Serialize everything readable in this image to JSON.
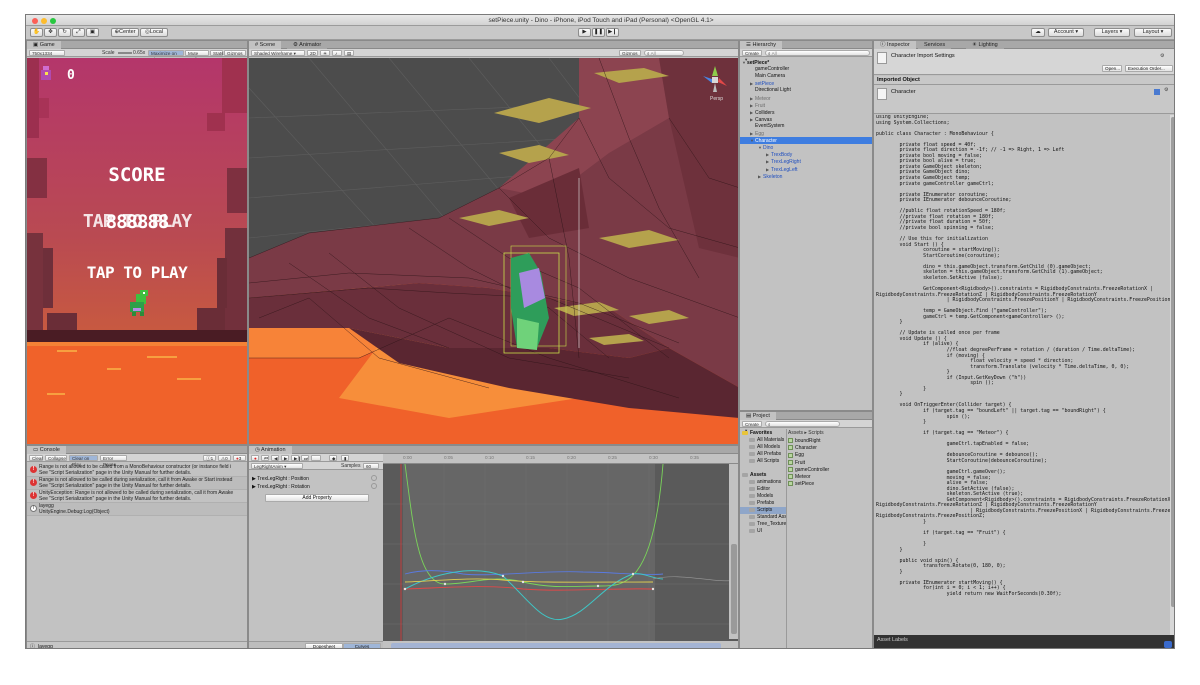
{
  "window": {
    "title": "setPiece.unity - Dino - iPhone, iPod Touch and iPad (Personal) <OpenGL 4.1>"
  },
  "toolbar": {
    "pivot_label": "Center",
    "space_label": "Local",
    "account_label": "Account",
    "layers_label": "Layers",
    "layout_label": "Layout"
  },
  "game": {
    "tab": "Game",
    "resolution": "750x1334",
    "scale_label": "Scale",
    "scale_value": "0.65x",
    "maximize": "Maximize on Play",
    "mute": "Mute audio",
    "stats": "Stats",
    "gizmos": "Gizmos",
    "counter": "0",
    "score_title": "SCORE",
    "score_digits": "888888",
    "overlap_text": "TAP TO PLAY",
    "tap_to_play": "TAP TO PLAY"
  },
  "scene": {
    "tab": "Scene",
    "animator_tab": "Animator",
    "shading": "Shaded Wireframe",
    "mode_2d": "2D",
    "gizmos": "Gizmos",
    "search_placeholder": "All",
    "persp": "Persp"
  },
  "console": {
    "tab": "Console",
    "buttons": [
      "Clear",
      "Collapse",
      "Clear on Play",
      "Error Pause"
    ],
    "counts": {
      "info": "1",
      "warn": "0",
      "err": "3"
    },
    "entries": [
      {
        "type": "error",
        "line1": "Range is not allowed to be called from a MonoBehaviour constructor (or instance field i",
        "line2": "See \"Script Serialization\" page in the Unity Manual for further details."
      },
      {
        "type": "error",
        "line1": "Range is not allowed to be called during serialization, call it from Awake or Start instead",
        "line2": "See \"Script Serialization\" page in the Unity Manual for further details."
      },
      {
        "type": "error",
        "line1": "UnityException: Range is not allowed to be called during serialization, call it from Awake",
        "line2": "See \"Script Serialization\" page in the Unity Manual for further details."
      },
      {
        "type": "info",
        "line1": "layegg",
        "line2": "UnityEngine.Debug:Log(Object)"
      }
    ],
    "status": "layegg"
  },
  "animation": {
    "tab": "Animation",
    "clip": "LegRightAnim",
    "samples_label": "Samples",
    "samples_value": "60",
    "properties": [
      "TrexLegRight : Position",
      "TrexLegRight : Rotation"
    ],
    "add_property": "Add Property",
    "dopesheet": "Dopesheet",
    "curves": "Curves",
    "timeline": [
      "0:00",
      "0:05",
      "0:10",
      "0:15",
      "0:20",
      "0:25",
      "0:30",
      "0:35"
    ]
  },
  "hierarchy": {
    "tab": "Hierarchy",
    "create": "Create",
    "search_placeholder": "All",
    "items": [
      {
        "label": "setPiece*",
        "indent": 0,
        "style": "bold",
        "arrow": "▼"
      },
      {
        "label": "gameController",
        "indent": 1,
        "style": "normal",
        "arrow": ""
      },
      {
        "label": "Main Camera",
        "indent": 1,
        "style": "normal",
        "arrow": ""
      },
      {
        "label": "setPiece",
        "indent": 1,
        "style": "blue",
        "arrow": "▶"
      },
      {
        "label": "Directional Light",
        "indent": 1,
        "style": "normal",
        "arrow": ""
      },
      {
        "label": "Meteor",
        "indent": 1,
        "style": "grey",
        "arrow": "▶"
      },
      {
        "label": "Fruit",
        "indent": 1,
        "style": "grey",
        "arrow": "▶"
      },
      {
        "label": "Colliders",
        "indent": 1,
        "style": "normal",
        "arrow": "▶"
      },
      {
        "label": "Canvas",
        "indent": 1,
        "style": "normal",
        "arrow": "▶"
      },
      {
        "label": "EventSystem",
        "indent": 1,
        "style": "normal",
        "arrow": ""
      },
      {
        "label": "Egg",
        "indent": 1,
        "style": "grey",
        "arrow": "▶"
      },
      {
        "label": "Character",
        "indent": 1,
        "style": "selected",
        "arrow": "▼"
      },
      {
        "label": "Dino",
        "indent": 2,
        "style": "blue",
        "arrow": "▼"
      },
      {
        "label": "TrexBody",
        "indent": 3,
        "style": "blue",
        "arrow": "▶"
      },
      {
        "label": "TrexLegRight",
        "indent": 3,
        "style": "blue",
        "arrow": "▶"
      },
      {
        "label": "TrexLegLeft",
        "indent": 3,
        "style": "blue",
        "arrow": "▶"
      },
      {
        "label": "Skeleton",
        "indent": 2,
        "style": "blue",
        "arrow": "▶"
      }
    ]
  },
  "project": {
    "tab": "Project",
    "create": "Create",
    "breadcrumb": "Assets ▸ Scripts",
    "tree": [
      {
        "label": "Favorites",
        "indent": 0,
        "bold": true
      },
      {
        "label": "All Materials",
        "indent": 1
      },
      {
        "label": "All Models",
        "indent": 1
      },
      {
        "label": "All Prefabs",
        "indent": 1
      },
      {
        "label": "All Scripts",
        "indent": 1
      },
      {
        "label": "",
        "indent": 0
      },
      {
        "label": "Assets",
        "indent": 0,
        "bold": true
      },
      {
        "label": "animations",
        "indent": 1
      },
      {
        "label": "Editor",
        "indent": 1
      },
      {
        "label": "Models",
        "indent": 1
      },
      {
        "label": "Prefabs",
        "indent": 1
      },
      {
        "label": "Scripts",
        "indent": 1,
        "selected": true
      },
      {
        "label": "Standard Assets",
        "indent": 1
      },
      {
        "label": "Tree_Textures",
        "indent": 1
      },
      {
        "label": "UI",
        "indent": 1
      }
    ],
    "files": [
      "boundRight",
      "Character",
      "Egg",
      "Fruit",
      "gameController",
      "Meteor",
      "setPiece"
    ]
  },
  "inspector": {
    "tab": "Inspector",
    "services_tab": "Services",
    "lighting_tab": "Lighting",
    "header": "Character Import Settings",
    "open_button": "Open...",
    "exec_order_button": "Execution Order...",
    "imported_object": "Imported Object",
    "object_name": "Character",
    "asset_labels": "Asset Labels",
    "code": [
      "using UnityEngine;",
      "using System.Collections;",
      "",
      "public class Character : MonoBehaviour {",
      "",
      "        private float speed = 40f;",
      "        private float direction = -1f; // -1 => Right, 1 => Left",
      "        private bool moving = false;",
      "        private bool alive = true;",
      "        private GameObject skeleton;",
      "        private GameObject dino;",
      "        private GameObject temp;",
      "        private gameController gameCtrl;",
      "",
      "        private IEnumerator coroutine;",
      "        private IEnumerator debounceCoroutine;",
      "",
      "        //public float rotationSpeed = 180f;",
      "        //private float rotation = 180f;",
      "        //private float duration = 50f;",
      "        //private bool spinning = false;",
      "",
      "        // Use this for initialization",
      "        void Start () {",
      "                coroutine = startMoving();",
      "                StartCoroutine(coroutine);",
      "",
      "                dino = this.gameObject.transform.GetChild (0).gameObject;",
      "                skeleton = this.gameObject.transform.GetChild (1).gameObject;",
      "                skeleton.SetActive (false);",
      "",
      "                GetComponent<Rigidbody>().constraints = RigidbodyConstraints.FreezeRotationX |",
      "RigidbodyConstraints.FreezeRotationZ | RigidbodyConstraints.FreezeRotationY",
      "                        | RigidbodyConstraints.FreezePositionY | RigidbodyConstraints.FreezePositionZ;",
      "",
      "                temp = GameObject.Find (\"gameController\");",
      "                gameCtrl = temp.GetComponent<gameController> ();",
      "        }",
      "",
      "        // Update is called once per frame",
      "        void Update () {",
      "                if (alive) {",
      "                        //float degreePerFrame = rotation / (duration / Time.deltaTime);",
      "                        if (moving) {",
      "                                float velocity = speed * direction;",
      "                                transform.Translate (velocity * Time.deltaTime, 0, 0);",
      "                        }",
      "                        if (Input.GetKeyDown (\"h\"))",
      "                                spin ();",
      "                }",
      "        }",
      "",
      "        void OnTriggerEnter(Collider target) {",
      "                if (target.tag == \"boundLeft\" || target.tag == \"boundRight\") {",
      "                        spin ();",
      "                }",
      "",
      "                if (target.tag == \"Meteor\") {",
      "",
      "                        gameCtrl.tapEnabled = false;",
      "",
      "                        debounceCoroutine = debounce();",
      "                        StartCoroutine(debounceCoroutine);",
      "",
      "                        gameCtrl.gameOver();",
      "                        moving = false;",
      "                        alive = false;",
      "                        dino.SetActive (false);",
      "                        skeleton.SetActive (true);",
      "                        GetComponent<Rigidbody>().constraints = RigidbodyConstraints.FreezeRotationX |",
      "RigidbodyConstraints.FreezeRotationZ | RigidbodyConstraints.FreezeRotationY",
      "                                | RigidbodyConstraints.FreezePositionX | RigidbodyConstraints.FreezePositionY |",
      "RigidbodyConstraints.FreezePositionZ;",
      "                }",
      "",
      "                if (target.tag == \"Fruit\") {",
      "",
      "                }",
      "        }",
      "",
      "        public void spin() {",
      "                transform.Rotate(0, 180, 0);",
      "        }",
      "",
      "        private IEnumerator startMoving() {",
      "                for(int i = 0; i < 1; i++) {",
      "                        yield return new WaitForSeconds(0.30f);"
    ]
  },
  "colors": {
    "selection": "#3e7de0",
    "error": "#dd3333",
    "sky_top": "#b73c6c",
    "lava": "#f05a2a",
    "rock": "#7a3a44",
    "mesa_top": "#b2a04a"
  }
}
